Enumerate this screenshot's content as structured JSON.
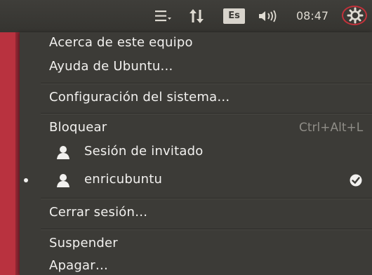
{
  "topbar": {
    "icons": [
      "menu-dropdown-icon",
      "network-transfer-icon",
      "volume-icon",
      "gear-icon"
    ],
    "language": "Es",
    "time": "08:47"
  },
  "menu": {
    "about": "Acerca de este equipo",
    "help": "Ayuda de Ubuntu…",
    "settings": "Configuración del sistema…",
    "lock": "Bloquear",
    "lock_shortcut": "Ctrl+Alt+L",
    "guest_session": "Sesión de invitado",
    "current_user": "enricubuntu",
    "logout": "Cerrar sesión…",
    "suspend": "Suspender",
    "shutdown": "Apagar…"
  },
  "colors": {
    "panel": "#3c3b37",
    "launcher": "#b9323f",
    "highlight_ring": "#c2313a"
  }
}
